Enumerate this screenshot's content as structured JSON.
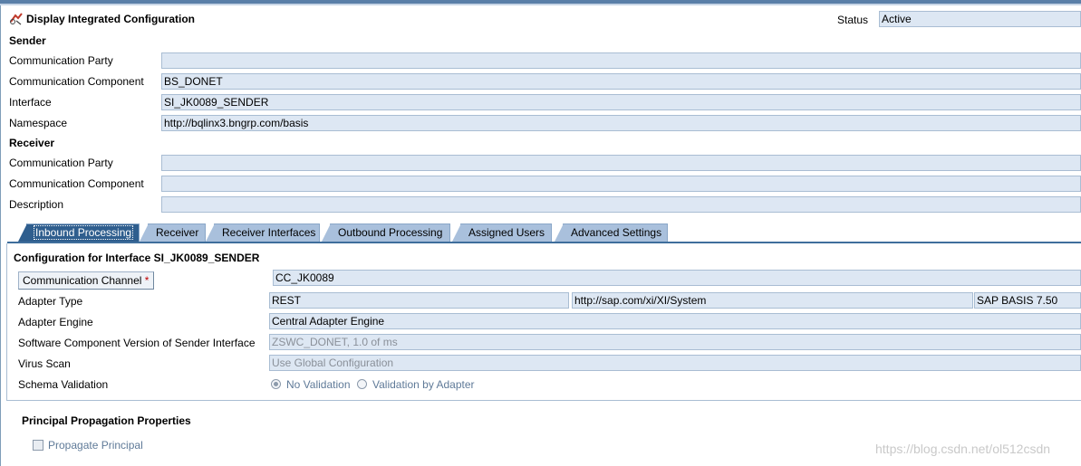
{
  "header": {
    "title": "Display Integrated Configuration",
    "status_label": "Status",
    "status_value": "Active"
  },
  "sender": {
    "section_title": "Sender",
    "fields": [
      {
        "label": "Communication Party",
        "value": ""
      },
      {
        "label": "Communication Component",
        "value": "BS_DONET"
      },
      {
        "label": "Interface",
        "value": "SI_JK0089_SENDER"
      },
      {
        "label": "Namespace",
        "value": "http://bqlinx3.bngrp.com/basis"
      }
    ]
  },
  "receiver": {
    "section_title": "Receiver",
    "fields": [
      {
        "label": "Communication Party",
        "value": ""
      },
      {
        "label": "Communication Component",
        "value": ""
      },
      {
        "label": "Description",
        "value": ""
      }
    ]
  },
  "tabs": [
    {
      "label": "Inbound Processing",
      "active": true
    },
    {
      "label": "Receiver",
      "active": false
    },
    {
      "label": "Receiver Interfaces",
      "active": false
    },
    {
      "label": "Outbound Processing",
      "active": false
    },
    {
      "label": "Assigned Users",
      "active": false
    },
    {
      "label": "Advanced Settings",
      "active": false
    }
  ],
  "inbound": {
    "config_title": "Configuration for Interface SI_JK0089_SENDER",
    "channel_label": "Communication Channel",
    "required_marker": "*",
    "channel_value": "CC_JK0089",
    "adapter_type_label": "Adapter Type",
    "adapter_type_value": "REST",
    "adapter_type_namespace": "http://sap.com/xi/XI/System",
    "adapter_type_swcv": "SAP BASIS 7.50",
    "adapter_engine_label": "Adapter Engine",
    "adapter_engine_value": "Central Adapter Engine",
    "swcv_label": "Software Component Version of Sender Interface",
    "swcv_value": "ZSWC_DONET, 1.0 of ms",
    "virus_scan_label": "Virus Scan",
    "virus_scan_value": "Use Global Configuration",
    "schema_validation_label": "Schema Validation",
    "schema_options": [
      {
        "label": "No Validation",
        "checked": true
      },
      {
        "label": "Validation by Adapter",
        "checked": false
      }
    ]
  },
  "principal": {
    "section_title": "Principal Propagation Properties",
    "propagate_label": "Propagate Principal",
    "propagate_checked": false
  },
  "watermark": "https://blog.csdn.net/ol512csdn",
  "colors": {
    "field_bg": "#dde7f3",
    "tab_bg": "#a9c0dc",
    "tab_active_bg": "#2f5e8e",
    "required": "#c00000"
  },
  "icons": {
    "title_icon": "integrated-configuration-icon"
  }
}
